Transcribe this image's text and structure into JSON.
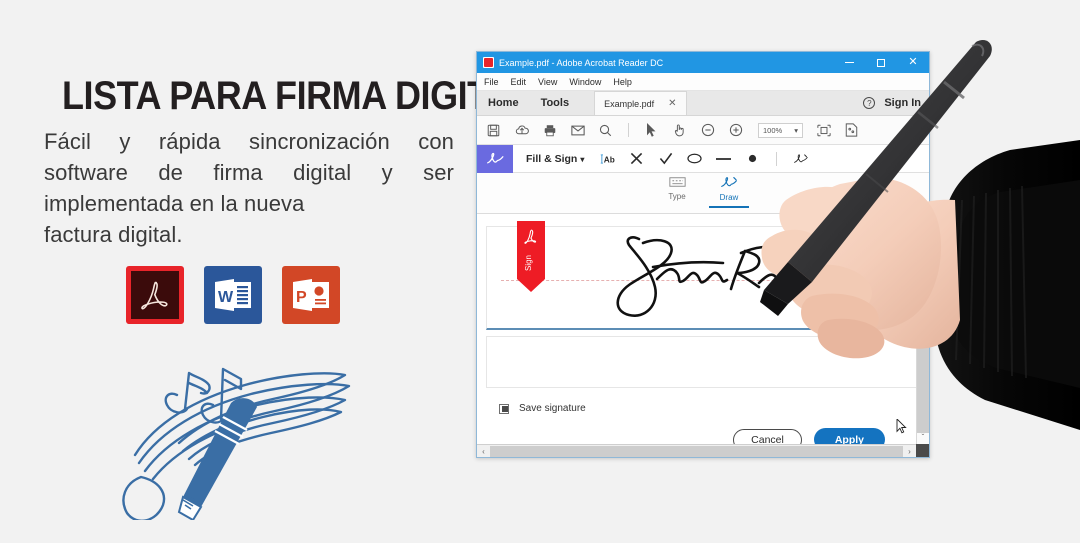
{
  "page": {
    "background_color": "#f2f2f2",
    "headline": "LISTA PARA FIRMA DIGITAL",
    "body_line1": "Fácil y rápida sincronización con software de firma digital y ser implementada en la nueva",
    "body_line2": "factura digital."
  },
  "app_logos": [
    {
      "name": "adobe-acrobat-logo",
      "glyph": "A",
      "bg": "#e8242a",
      "inner_bg": "#3b0b0b"
    },
    {
      "name": "microsoft-word-logo",
      "glyph": "W",
      "bg": "#2b579a"
    },
    {
      "name": "microsoft-powerpoint-logo",
      "glyph": "P",
      "bg": "#d24726"
    }
  ],
  "brand_logo": {
    "name": "music-note-pencil-logo",
    "color": "#3a6ea5"
  },
  "acrobat": {
    "titlebar": {
      "title": "Example.pdf - Adobe Acrobat Reader DC",
      "color": "#2196e3",
      "minimize": "─",
      "maximize": "□",
      "close": "✕"
    },
    "menubar": [
      "File",
      "Edit",
      "View",
      "Window",
      "Help"
    ],
    "tabstrip": {
      "home": "Home",
      "tools": "Tools",
      "doc_tab": "Example.pdf",
      "doc_tab_close": "✕",
      "help": "?",
      "sign_in": "Sign In"
    },
    "toolbar": {
      "zoom_value": "100%",
      "zoom_caret": "▾",
      "icons": [
        "save-icon",
        "upload-cloud-icon",
        "print-icon",
        "email-icon",
        "search-icon",
        "select-cursor-icon",
        "hand-tool-icon",
        "zoom-out-icon",
        "zoom-in-icon",
        "fit-page-icon",
        "page-thumbnail-icon"
      ]
    },
    "fill_and_sign": {
      "badge_icon": "signature-badge-icon",
      "label": "Fill & Sign",
      "caret": "▾",
      "tools": [
        "text-Ab-icon",
        "cross-x-icon",
        "check-mark-icon",
        "ellipse-icon",
        "line-icon",
        "dot-icon",
        "sign-pen-icon"
      ]
    },
    "mode_tabs": [
      {
        "label": "Type",
        "icon": "keyboard-icon",
        "active": false
      },
      {
        "label": "Draw",
        "icon": "draw-pen-icon",
        "active": true
      }
    ],
    "signature_area": {
      "bookmark_label": "Sign",
      "bookmark_color": "#ee1c25",
      "signature_alt": "handwritten-signature"
    },
    "save_signature": {
      "label": "Save signature",
      "checked": true
    },
    "buttons": {
      "cancel": "Cancel",
      "apply": "Apply",
      "apply_color": "#1473c0"
    },
    "scrollbars": {
      "left_arrow": "‹",
      "right_arrow": "›",
      "down_arrow": "ˇ"
    }
  }
}
